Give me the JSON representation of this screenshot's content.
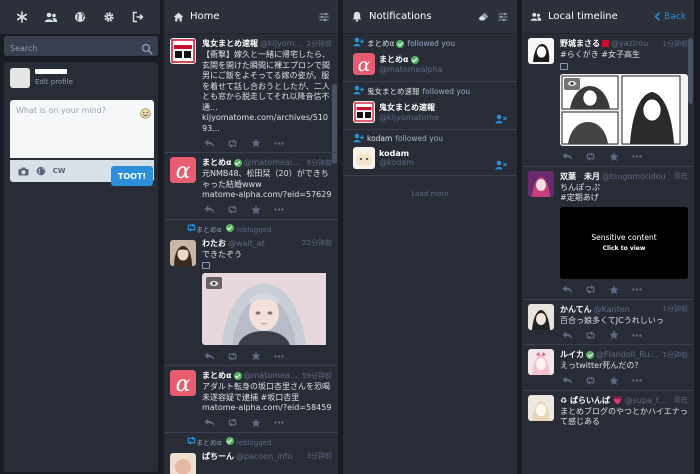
{
  "drawer": {
    "nav_icons": [
      "asterisk-icon",
      "people-icon",
      "globe-icon",
      "gear-icon",
      "sign-out-icon"
    ],
    "search_placeholder": "Search",
    "edit_profile": "Edit profile",
    "compose_placeholder": "What is on your mind?",
    "cw_label": "CW",
    "char_count": "500",
    "toot_label": "TOOT!"
  },
  "home": {
    "title": "Home",
    "statuses": [
      {
        "name": "鬼女まとめ速報",
        "acct": "@kijyom...",
        "time": "2分钟前",
        "content": "【衝撃】嫁久と一緒に帰宅したら、玄関を開けた瞬間に裸エプロンで間男にご飯をよそってる嫁の姿が。服を着せて話し合おうとしたが、二人とも窓から脱走してそれ以降音信不通...\nkijyomatome.com/archives/51093..."
      },
      {
        "name": "まとめα",
        "acct": "@matomealp...",
        "time": "9分钟前",
        "content": "元NMB48、松田栞（20）ができちゃった結婚www\nmatome-alpha.com/?eid=57629"
      },
      {
        "reblog_by": "まとめα",
        "reblog_text": "reblogged",
        "name": "わたお",
        "acct": "@wait_at",
        "time": "22分钟前",
        "content": "できたぞう"
      },
      {
        "name": "まとめα",
        "acct": "@matomeal...",
        "time": "59分钟前",
        "content": "アダルト転身の坂口杏里さんを恐喝未遂容疑で逮捕 #坂口杏里\nmatome-alpha.com/?eid=58459"
      },
      {
        "reblog_by": "まとめα",
        "reblog_text": "reblogged",
        "name": "ぱちーん",
        "acct": "@pacoon_info",
        "time": "3分钟前",
        "content": ""
      }
    ]
  },
  "notifications": {
    "title": "Notifications",
    "items": [
      {
        "follower": "まとめα",
        "action": "followed you",
        "name": "まとめα",
        "acct": "@matomealpha",
        "verified": true
      },
      {
        "follower": "鬼女まとめ速報",
        "action": "followed you",
        "name": "鬼女まとめ速報",
        "acct": "@kijyomatome",
        "verified": false
      },
      {
        "follower": "kodam",
        "action": "followed you",
        "name": "kodam",
        "acct": "@kodam",
        "verified": false
      }
    ],
    "load_more": "Load more"
  },
  "local": {
    "title": "Local timeline",
    "back_label": "Back",
    "statuses": [
      {
        "name": "野城まさる",
        "acct": "@yazirou",
        "time": "1分钟前",
        "content": "#らくがき #女子高生"
      },
      {
        "name": "双葉　未月",
        "acct": "@tsugomoridou",
        "time": "现在",
        "content": "ちんぽっぷ\n#定期あげ",
        "sensitive_title": "Sensitive content",
        "sensitive_sub": "Click to view"
      },
      {
        "name": "かんてん",
        "acct": "@Kanten",
        "time": "1分钟前",
        "content": "百合っ娘多くてJCうれしいっ"
      },
      {
        "name": "ルイカ",
        "acct": "@Flandoll_Rui...",
        "time": "1分钟前",
        "content": "えっtwitter死んだの？"
      },
      {
        "name": "♻ ぱらいんぱ 💗",
        "acct": "@supa_t...",
        "time": "现在",
        "content": "まとめブログのやつとかハイエナって感じある"
      }
    ]
  },
  "colors": {
    "background": "#191b22",
    "column": "#282c37",
    "header": "#2b303b",
    "accent": "#2b90d9",
    "verified": "#59b264",
    "muted": "#606984"
  }
}
